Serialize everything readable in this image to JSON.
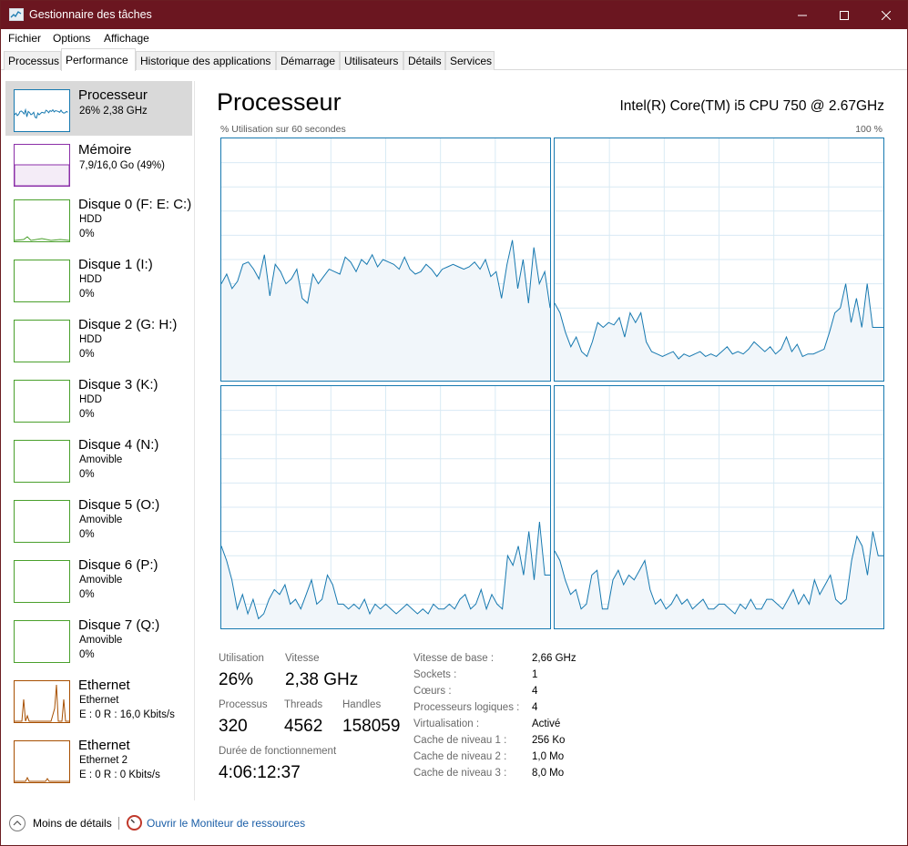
{
  "window": {
    "title": "Gestionnaire des tâches"
  },
  "menu": [
    "Fichier",
    "Options",
    "Affichage"
  ],
  "tabs": [
    "Processus",
    "Performance",
    "Historique des applications",
    "Démarrage",
    "Utilisateurs",
    "Détails",
    "Services"
  ],
  "active_tab": "Performance",
  "sidebar": [
    {
      "name": "Processeur",
      "line1": "26% 2,38 GHz",
      "line2": "",
      "color": "#1779b0",
      "selected": true
    },
    {
      "name": "Mémoire",
      "line1": "7,9/16,0 Go (49%)",
      "line2": "",
      "color": "#8b2fa8"
    },
    {
      "name": "Disque 0 (F: E: C:)",
      "line1": "HDD",
      "line2": "0%",
      "color": "#4aa02c"
    },
    {
      "name": "Disque 1 (I:)",
      "line1": "HDD",
      "line2": "0%",
      "color": "#4aa02c"
    },
    {
      "name": "Disque 2 (G: H:)",
      "line1": "HDD",
      "line2": "0%",
      "color": "#4aa02c"
    },
    {
      "name": "Disque 3 (K:)",
      "line1": "HDD",
      "line2": "0%",
      "color": "#4aa02c"
    },
    {
      "name": "Disque 4 (N:)",
      "line1": "Amovible",
      "line2": "0%",
      "color": "#4aa02c"
    },
    {
      "name": "Disque 5 (O:)",
      "line1": "Amovible",
      "line2": "0%",
      "color": "#4aa02c"
    },
    {
      "name": "Disque 6 (P:)",
      "line1": "Amovible",
      "line2": "0%",
      "color": "#4aa02c"
    },
    {
      "name": "Disque 7 (Q:)",
      "line1": "Amovible",
      "line2": "0%",
      "color": "#4aa02c"
    },
    {
      "name": "Ethernet",
      "line1": "Ethernet",
      "line2": "E : 0 R : 16,0 Kbits/s",
      "color": "#a74f01"
    },
    {
      "name": "Ethernet",
      "line1": "Ethernet 2",
      "line2": "E : 0 R : 0 Kbits/s",
      "color": "#a74f01"
    }
  ],
  "main": {
    "title": "Processeur",
    "model": "Intel(R) Core(TM) i5 CPU 750 @ 2.67GHz",
    "graph_caption": "% Utilisation sur 60 secondes",
    "graph_max": "100 %"
  },
  "stats": {
    "utilisation_label": "Utilisation",
    "utilisation": "26%",
    "vitesse_label": "Vitesse",
    "vitesse": "2,38 GHz",
    "processus_label": "Processus",
    "processus": "320",
    "threads_label": "Threads",
    "threads": "4562",
    "handles_label": "Handles",
    "handles": "158059",
    "uptime_label": "Durée de fonctionnement",
    "uptime": "4:06:12:37"
  },
  "details": [
    {
      "label": "Vitesse de base :",
      "value": "2,66 GHz"
    },
    {
      "label": "Sockets :",
      "value": "1"
    },
    {
      "label": "Cœurs :",
      "value": "4"
    },
    {
      "label": "Processeurs logiques :",
      "value": "4"
    },
    {
      "label": "Virtualisation :",
      "value": "Activé"
    },
    {
      "label": "Cache de niveau 1 :",
      "value": "256 Ko"
    },
    {
      "label": "Cache de niveau 2 :",
      "value": "1,0 Mo"
    },
    {
      "label": "Cache de niveau 3 :",
      "value": "8,0 Mo"
    }
  ],
  "footer": {
    "less": "Moins de détails",
    "monitor": "Ouvrir le Moniteur de ressources"
  },
  "colors": {
    "accent": "#1779b0",
    "titlebar": "#6b1620",
    "fill": "#f1f6fa",
    "grid": "#d9eaf4"
  },
  "cpu_series": [
    [
      40,
      44,
      38,
      41,
      48,
      49,
      46,
      42,
      52,
      35,
      48,
      45,
      40,
      42,
      46,
      34,
      32,
      44,
      40,
      43,
      46,
      45,
      44,
      51,
      49,
      45,
      50,
      48,
      52,
      47,
      50,
      49,
      48,
      46,
      51,
      46,
      44,
      45,
      48,
      46,
      43,
      46,
      47,
      48,
      47,
      46,
      47,
      49,
      46,
      50,
      43,
      45,
      34,
      48,
      58,
      38,
      50,
      32,
      55,
      40,
      45,
      30
    ],
    [
      32,
      28,
      20,
      14,
      18,
      12,
      10,
      16,
      24,
      22,
      24,
      23,
      26,
      18,
      28,
      24,
      28,
      16,
      12,
      11,
      10,
      11,
      12,
      9,
      11,
      10,
      11,
      12,
      10,
      11,
      10,
      12,
      14,
      11,
      12,
      11,
      13,
      16,
      14,
      12,
      14,
      11,
      13,
      18,
      12,
      15,
      10,
      11,
      11,
      12,
      13,
      20,
      28,
      30,
      40,
      24,
      34,
      22,
      40,
      22,
      22,
      22
    ],
    [
      34,
      28,
      20,
      8,
      14,
      6,
      12,
      4,
      6,
      12,
      16,
      14,
      18,
      10,
      12,
      8,
      14,
      20,
      10,
      12,
      22,
      18,
      10,
      10,
      8,
      10,
      8,
      12,
      6,
      10,
      8,
      10,
      8,
      6,
      8,
      10,
      8,
      6,
      8,
      6,
      10,
      8,
      8,
      10,
      8,
      12,
      14,
      8,
      10,
      16,
      8,
      14,
      10,
      8,
      30,
      26,
      34,
      22,
      40,
      20,
      44,
      22,
      22
    ],
    [
      32,
      28,
      20,
      14,
      16,
      8,
      10,
      22,
      24,
      8,
      8,
      20,
      24,
      18,
      22,
      20,
      24,
      28,
      16,
      10,
      12,
      8,
      10,
      14,
      10,
      12,
      8,
      10,
      12,
      8,
      8,
      10,
      10,
      8,
      6,
      10,
      8,
      12,
      8,
      8,
      12,
      12,
      10,
      8,
      12,
      16,
      10,
      14,
      10,
      20,
      14,
      18,
      22,
      12,
      10,
      12,
      28,
      38,
      34,
      22,
      40,
      30,
      30
    ]
  ]
}
